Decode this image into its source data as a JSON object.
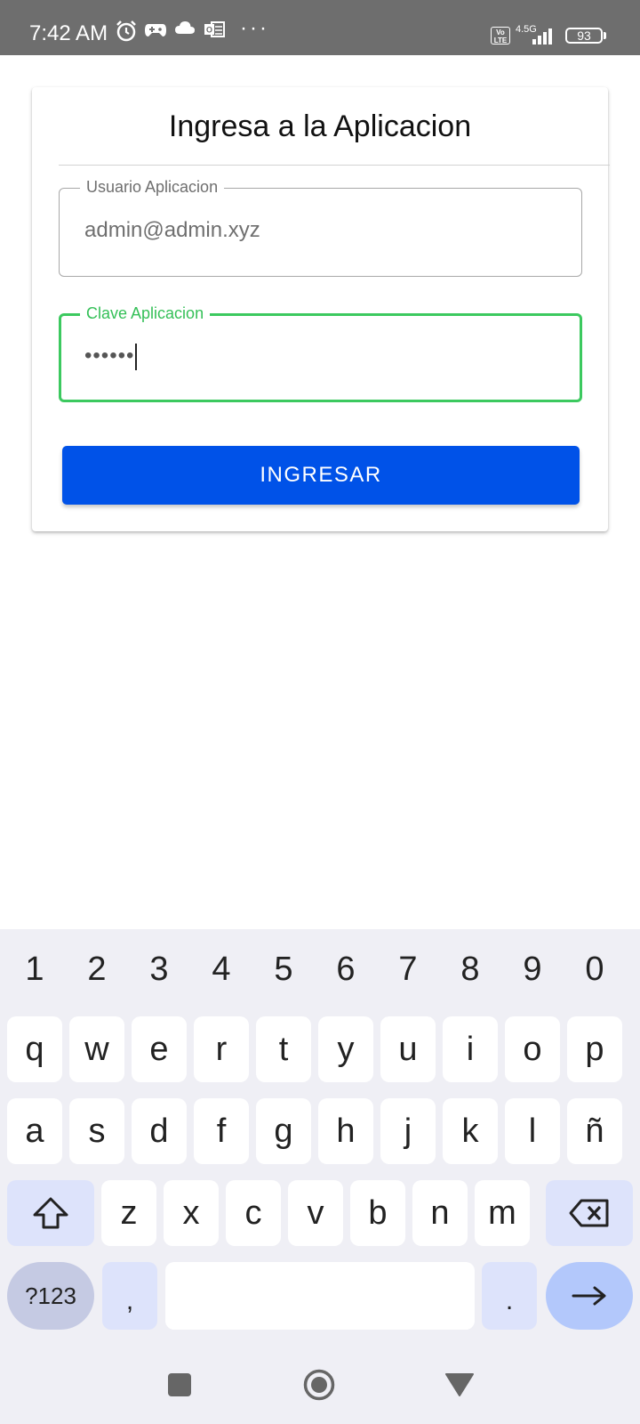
{
  "status_bar": {
    "time": "7:42 AM",
    "icons": [
      "alarm-icon",
      "game-controller-icon",
      "cloud-icon",
      "outlook-icon"
    ],
    "more": "···",
    "volte": "Vo LTE",
    "network": "4.5G",
    "battery": "93"
  },
  "login": {
    "title": "Ingresa a la Aplicacion",
    "user_label": "Usuario Aplicacion",
    "user_value": "admin@admin.xyz",
    "password_label": "Clave Aplicacion",
    "password_value": "••••••",
    "submit_label": "INGRESAR"
  },
  "colors": {
    "accent_button": "#0052e8",
    "focused_field": "#3cc95f",
    "status_bar": "#6e6e6e"
  },
  "keyboard": {
    "numbers": [
      "1",
      "2",
      "3",
      "4",
      "5",
      "6",
      "7",
      "8",
      "9",
      "0"
    ],
    "row1": [
      "q",
      "w",
      "e",
      "r",
      "t",
      "y",
      "u",
      "i",
      "o",
      "p"
    ],
    "row2": [
      "a",
      "s",
      "d",
      "f",
      "g",
      "h",
      "j",
      "k",
      "l",
      "ñ"
    ],
    "row3": [
      "z",
      "x",
      "c",
      "v",
      "b",
      "n",
      "m"
    ],
    "symbols_label": "?123",
    "comma": ",",
    "period": "."
  },
  "nav_bar": {
    "icons": [
      "recents-square-icon",
      "home-circle-icon",
      "back-triangle-icon"
    ]
  }
}
